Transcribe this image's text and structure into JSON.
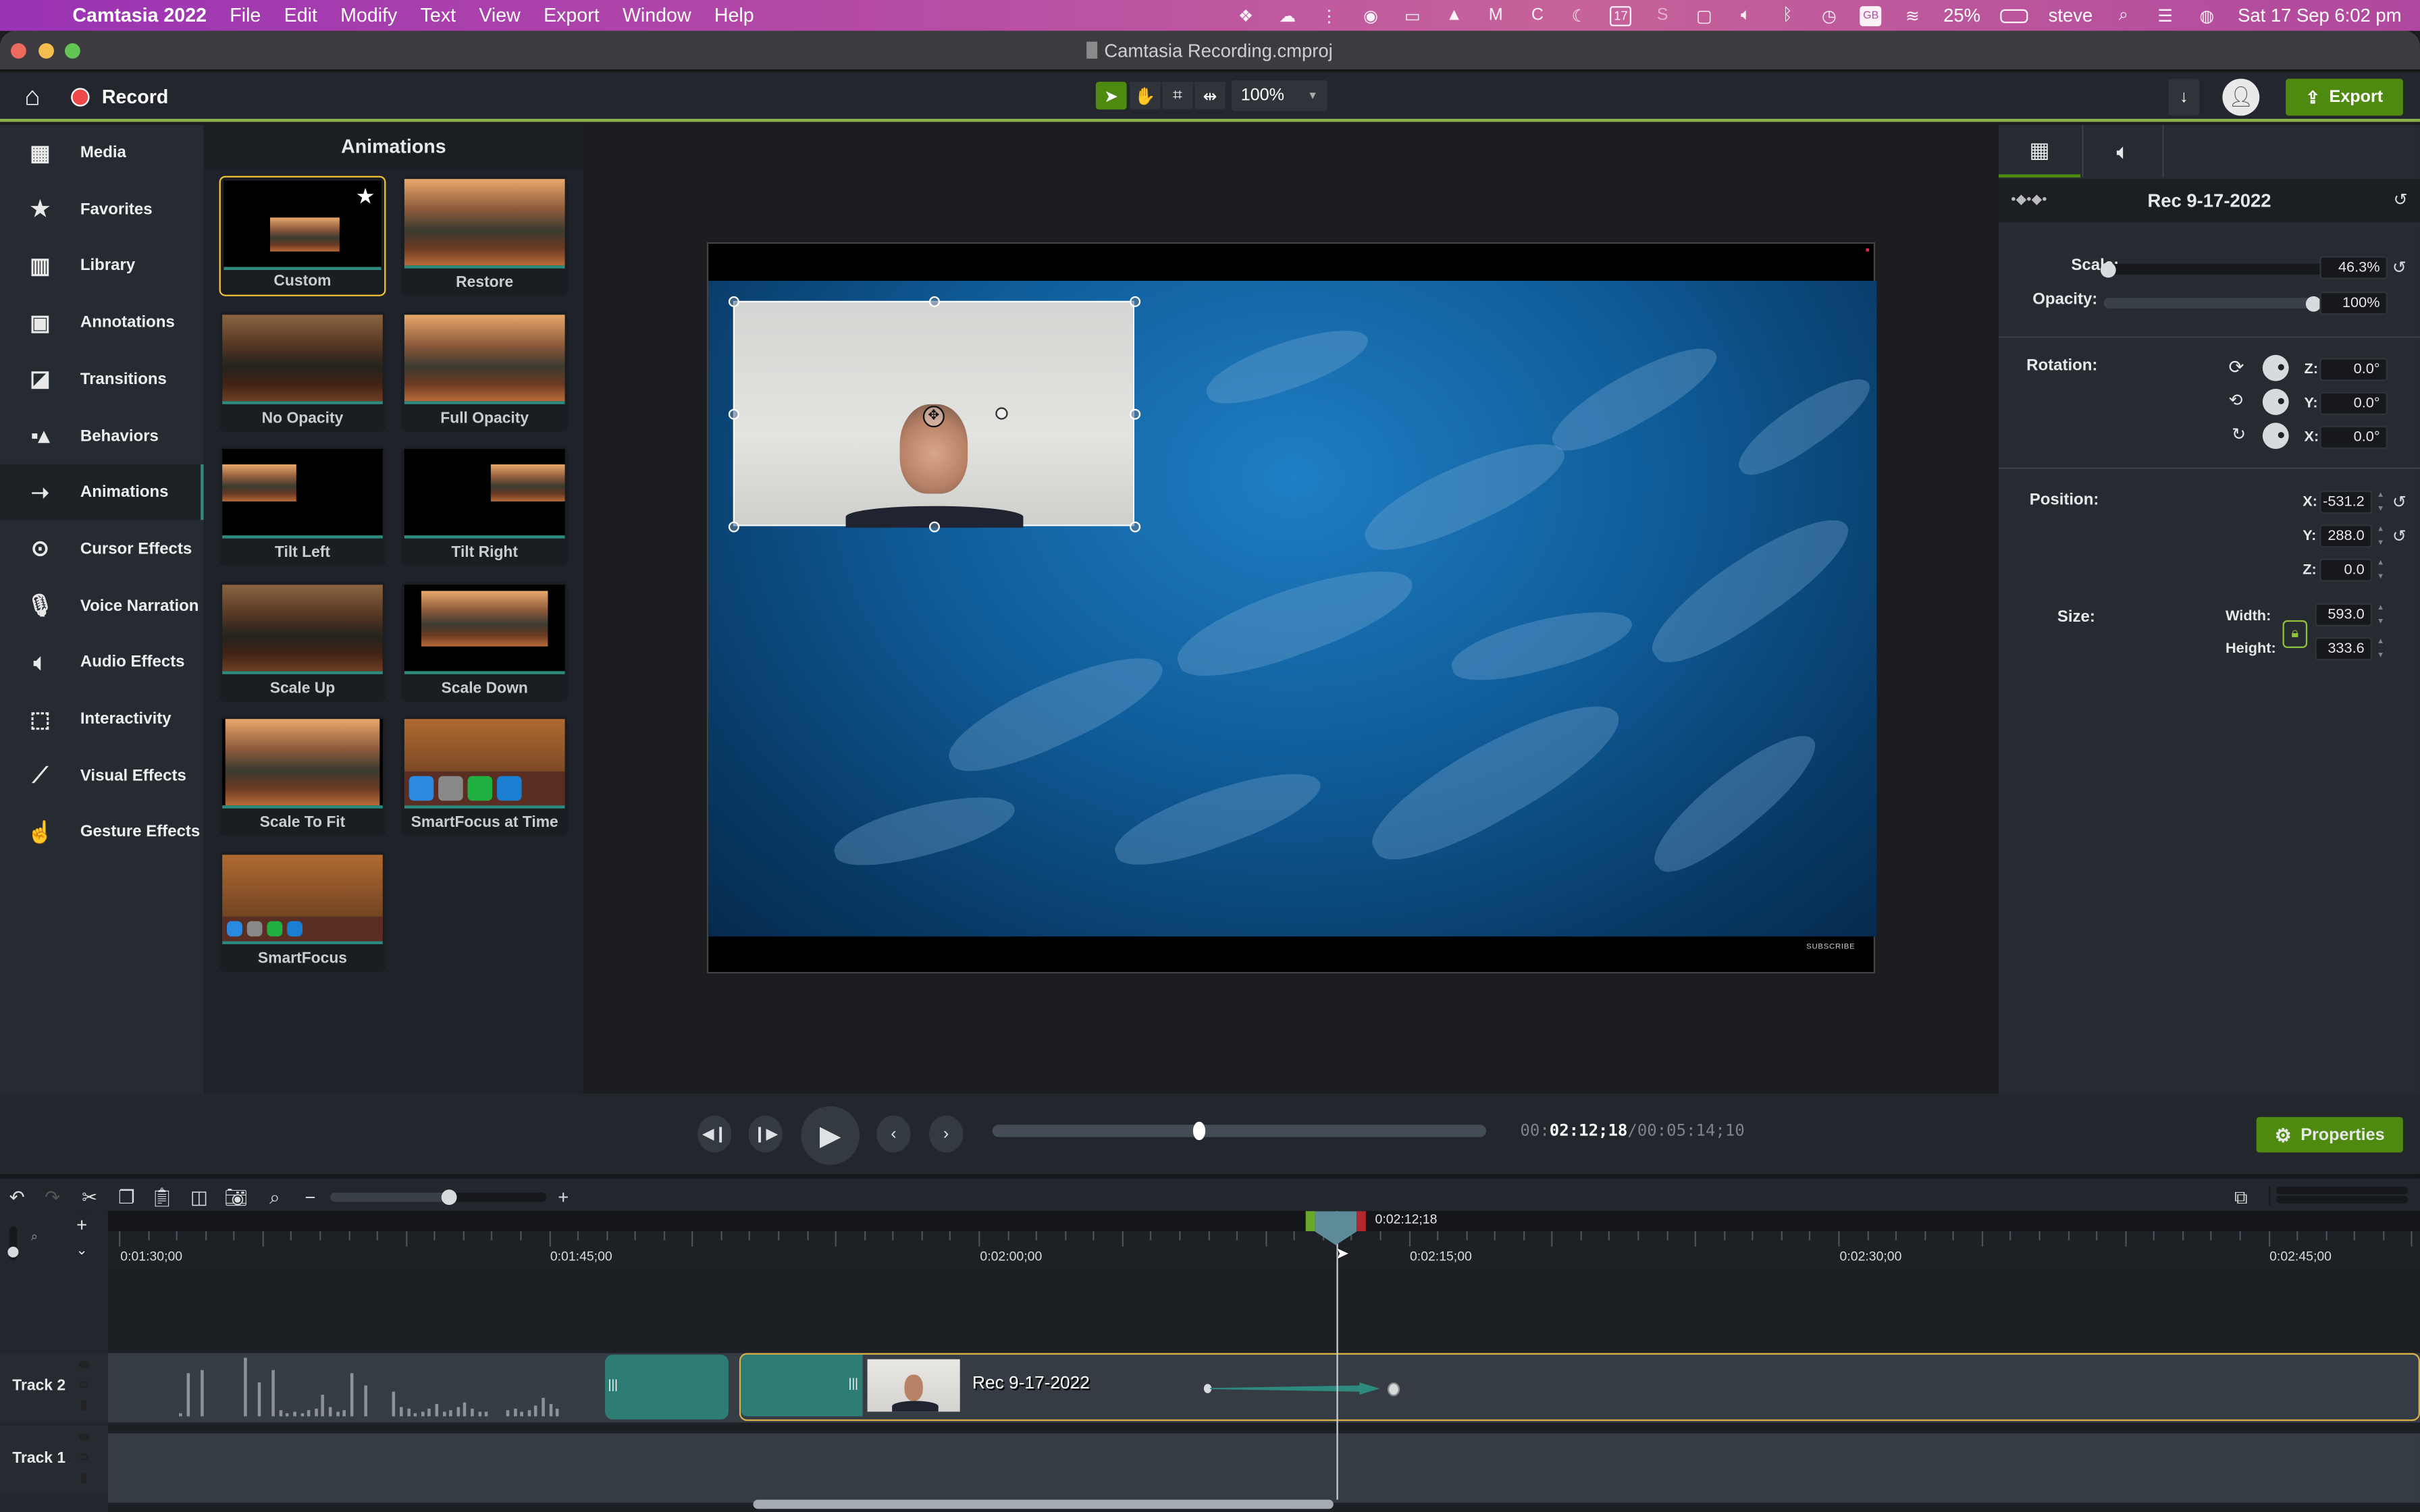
{
  "menubar": {
    "app_name": "Camtasia 2022",
    "menus": [
      "File",
      "Edit",
      "Modify",
      "Text",
      "View",
      "Export",
      "Window",
      "Help"
    ],
    "tray_icons": [
      "dropbox-icon",
      "creative-cloud-icon",
      "bartender-icon",
      "record-icon",
      "film-icon",
      "vpn-icon",
      "malwarebytes-icon",
      "c-icon",
      "moon-icon",
      "calendar-icon",
      "s-icon",
      "display-icon",
      "volume-icon",
      "bluetooth-icon",
      "time-machine-icon",
      "keyboard-gb-icon",
      "wifi-icon"
    ],
    "keyboard_layout": "GB",
    "calendar_day": "17",
    "battery": "25%",
    "user": "steve",
    "datetime": "Sat 17 Sep  6:02 pm"
  },
  "window": {
    "title": "Camtasia Recording.cmproj"
  },
  "toolbar": {
    "record_label": "Record",
    "zoom_value": "100%",
    "export_label": "Export",
    "accent": "#4f8a10"
  },
  "sidebar": {
    "items": [
      {
        "label": "Media",
        "icon": "film-icon"
      },
      {
        "label": "Favorites",
        "icon": "star-icon"
      },
      {
        "label": "Library",
        "icon": "library-icon"
      },
      {
        "label": "Annotations",
        "icon": "annotation-icon"
      },
      {
        "label": "Transitions",
        "icon": "transition-icon"
      },
      {
        "label": "Behaviors",
        "icon": "behaviors-icon"
      },
      {
        "label": "Animations",
        "icon": "animation-icon",
        "active": true
      },
      {
        "label": "Cursor Effects",
        "icon": "cursor-effects-icon"
      },
      {
        "label": "Voice Narration",
        "icon": "microphone-icon"
      },
      {
        "label": "Audio Effects",
        "icon": "audio-effects-icon"
      },
      {
        "label": "Interactivity",
        "icon": "interactivity-icon"
      },
      {
        "label": "Visual Effects",
        "icon": "magic-wand-icon"
      },
      {
        "label": "Gesture Effects",
        "icon": "gesture-icon"
      }
    ]
  },
  "animations": {
    "title": "Animations",
    "tiles": [
      {
        "label": "Custom",
        "selected": true,
        "favorite": true
      },
      {
        "label": "Restore"
      },
      {
        "label": "No Opacity"
      },
      {
        "label": "Full Opacity"
      },
      {
        "label": "Tilt Left"
      },
      {
        "label": "Tilt Right"
      },
      {
        "label": "Scale Up"
      },
      {
        "label": "Scale Down"
      },
      {
        "label": "Scale To Fit"
      },
      {
        "label": "SmartFocus at Time"
      },
      {
        "label": "SmartFocus"
      }
    ]
  },
  "canvas": {
    "overlay_text": "SUBSCRIBE"
  },
  "properties": {
    "clip_name": "Rec 9-17-2022",
    "scale_label": "Scale:",
    "scale_value": "46.3%",
    "scale_fraction": 0.02,
    "opacity_label": "Opacity:",
    "opacity_value": "100%",
    "opacity_fraction": 1.0,
    "rotation_label": "Rotation:",
    "rotation": {
      "z": "0.0°",
      "y": "0.0°",
      "x": "0.0°"
    },
    "position_label": "Position:",
    "position": {
      "x": "-531.2",
      "y": "288.0",
      "z": "0.0"
    },
    "size_label": "Size:",
    "width_label": "Width:",
    "height_label": "Height:",
    "width": "593.0",
    "height": "333.6",
    "axis": {
      "x": "X:",
      "y": "Y:",
      "z": "Z:"
    }
  },
  "transport": {
    "time_prefix": "00:",
    "time_current": "02:12;18",
    "time_total": "/00:05:14;10",
    "scrub_fraction": 0.42,
    "properties_label": "Properties"
  },
  "timeline": {
    "zoom_fraction": 0.55,
    "playhead_time": "0:02:12;18",
    "ruler_labels": [
      "0:01:30;00",
      "0:01:45;00",
      "0:02:00;00",
      "0:02:15;00",
      "0:02:30;00",
      "0:02:45;00"
    ],
    "tracks": [
      {
        "label": "Track 2"
      },
      {
        "label": "Track 1"
      }
    ],
    "clip_label": "Rec 9-17-2022"
  }
}
